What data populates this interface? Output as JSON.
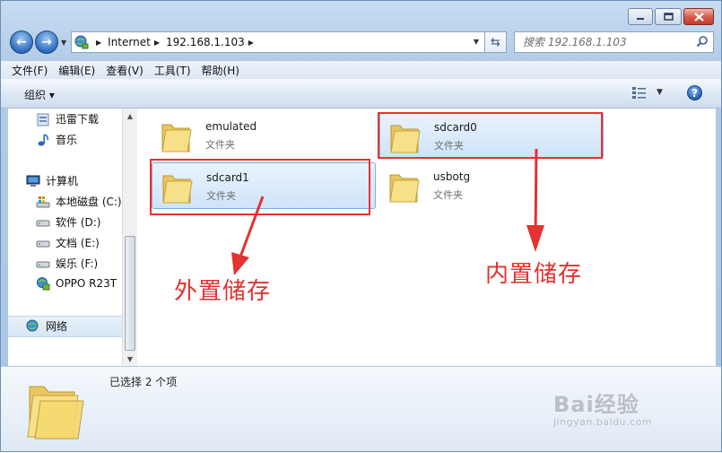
{
  "address": {
    "crumbs": [
      "Internet",
      "192.168.1.103"
    ]
  },
  "search": {
    "placeholder": "搜索 192.168.1.103"
  },
  "menu": [
    "文件(F)",
    "编辑(E)",
    "查看(V)",
    "工具(T)",
    "帮助(H)"
  ],
  "toolbar": {
    "organize_label": "组织 ▾"
  },
  "nav": {
    "favorites": [
      "迅雷下载",
      "音乐"
    ],
    "computer": "计算机",
    "drives": [
      "本地磁盘 (C:)",
      "软件 (D:)",
      "文档 (E:)",
      "娱乐 (F:)",
      "OPPO R23T"
    ],
    "network": "网络"
  },
  "folders": [
    {
      "name": "emulated",
      "type": "文件夹",
      "selected": false
    },
    {
      "name": "sdcard0",
      "type": "文件夹",
      "selected": true
    },
    {
      "name": "sdcard1",
      "type": "文件夹",
      "selected": true
    },
    {
      "name": "usbotg",
      "type": "文件夹",
      "selected": false
    }
  ],
  "annotations": {
    "external": "外置储存",
    "internal": "内置储存",
    "color": "#e3322f"
  },
  "details": {
    "selection": "已选择 2 个项"
  },
  "watermark": {
    "main": "Bai经验",
    "sub": "jingyan.baidu.com"
  }
}
